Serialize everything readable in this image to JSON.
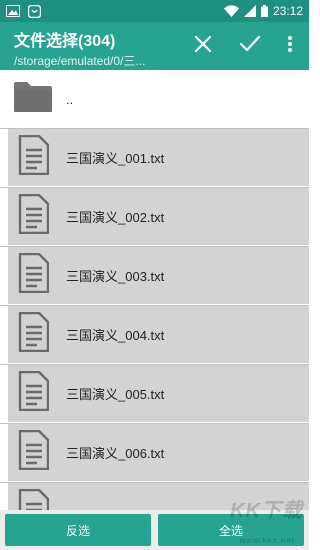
{
  "status_bar": {
    "time": "23:12",
    "icons": [
      "image-icon",
      "app-notification-icon",
      "wifi-icon",
      "signal-icon",
      "battery-icon"
    ]
  },
  "app_bar": {
    "title": "文件选择(304)",
    "path": "/storage/emulated/0/三...",
    "actions": [
      "close-icon",
      "check-icon",
      "more-vert-icon"
    ]
  },
  "list": {
    "parent_label": "..",
    "files": [
      {
        "name": "三国演义_001.txt"
      },
      {
        "name": "三国演义_002.txt"
      },
      {
        "name": "三国演义_003.txt"
      },
      {
        "name": "三国演义_004.txt"
      },
      {
        "name": "三国演义_005.txt"
      },
      {
        "name": "三国演义_006.txt"
      },
      {
        "name": ""
      }
    ]
  },
  "bottom": {
    "invert_label": "反选",
    "select_all_label": "全选"
  },
  "watermark": {
    "text": "KK下载",
    "sub": "www.kkx.net"
  },
  "colors": {
    "primary": "#26a391",
    "status": "#1e8f80",
    "selected_row": "#d3d3d3"
  }
}
